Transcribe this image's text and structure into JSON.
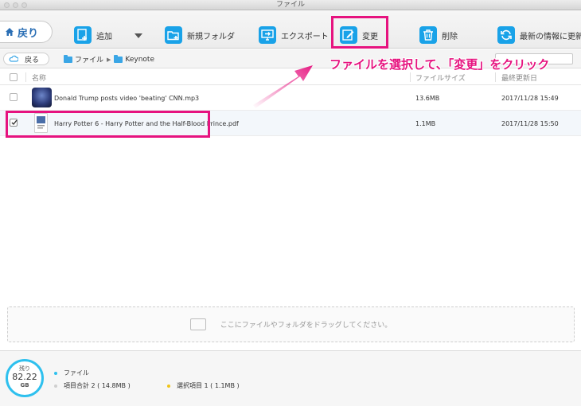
{
  "window": {
    "title": "ファイル"
  },
  "toolbar": {
    "back_label": "戻り",
    "buttons": [
      {
        "label": "追加",
        "icon": "add-file-icon"
      },
      {
        "label": "新規フォルダ",
        "icon": "new-folder-icon"
      },
      {
        "label": "エクスポート",
        "icon": "export-icon"
      },
      {
        "label": "変更",
        "icon": "edit-icon"
      },
      {
        "label": "削除",
        "icon": "trash-icon"
      },
      {
        "label": "最新の情報に更新",
        "icon": "refresh-icon"
      }
    ]
  },
  "pathbar": {
    "back_label": "戻る",
    "crumbs": [
      "ファイル",
      "Keynote"
    ]
  },
  "annotation": "ファイルを選択して、「変更」をクリック",
  "table": {
    "headers": {
      "name": "名称",
      "size": "ファイルサイズ",
      "date": "最終更新日"
    },
    "rows": [
      {
        "name": "Donald Trump posts video 'beating' CNN.mp3",
        "size": "13.6MB",
        "date": "2017/11/28  15:49",
        "checked": false
      },
      {
        "name": "Harry Potter 6 - Harry Potter and the Half-Blood Prince.pdf",
        "size": "1.1MB",
        "date": "2017/11/28  15:50",
        "checked": true
      }
    ]
  },
  "dropzone": {
    "text": "ここにファイルやフォルダをドラッグしてください。"
  },
  "footer": {
    "gauge_top": "残り",
    "gauge_value": "82.22",
    "gauge_unit": "GB",
    "category": "ファイル",
    "total": "項目合計 2 ( 14.8MB )",
    "selected": "選択項目 1 ( 1.1MB )"
  },
  "colors": {
    "accent": "#19a2e8",
    "highlight": "#e6137f",
    "gauge": "#2ec0ee",
    "dot_selected": "#f0c419"
  }
}
